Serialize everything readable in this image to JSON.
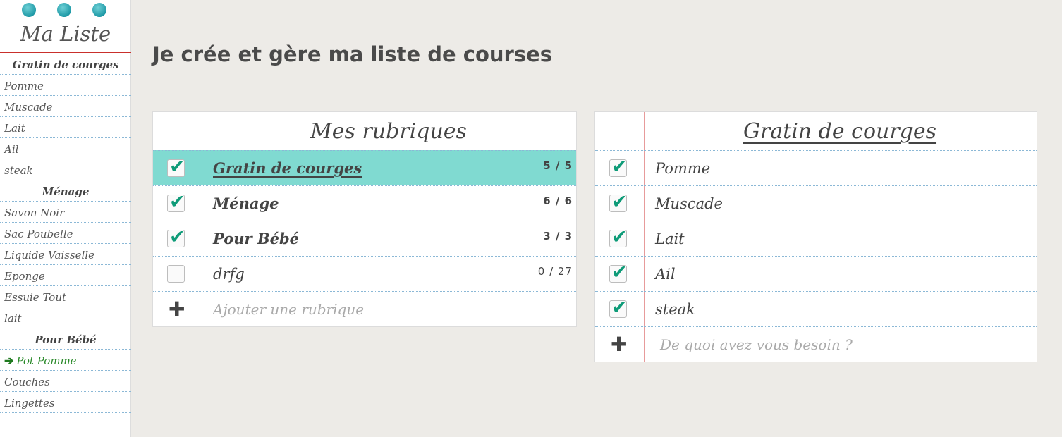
{
  "app": {
    "title": "Ma Liste"
  },
  "sidebar": {
    "rows": [
      {
        "label": "Gratin de courges",
        "type": "category"
      },
      {
        "label": "Pomme",
        "type": "item"
      },
      {
        "label": "Muscade",
        "type": "item"
      },
      {
        "label": "Lait",
        "type": "item"
      },
      {
        "label": "Ail",
        "type": "item"
      },
      {
        "label": "steak",
        "type": "item"
      },
      {
        "label": "Ménage",
        "type": "category"
      },
      {
        "label": "Savon Noir",
        "type": "item"
      },
      {
        "label": "Sac Poubelle",
        "type": "item"
      },
      {
        "label": "Liquide Vaisselle",
        "type": "item"
      },
      {
        "label": "Eponge",
        "type": "item"
      },
      {
        "label": "Essuie Tout",
        "type": "item"
      },
      {
        "label": "lait",
        "type": "item"
      },
      {
        "label": "Pour Bébé",
        "type": "category"
      },
      {
        "label": "Pot Pomme",
        "type": "item",
        "current": true
      },
      {
        "label": "Couches",
        "type": "item"
      },
      {
        "label": "Lingettes",
        "type": "item"
      }
    ],
    "current_icon": "arrow-right-icon"
  },
  "main": {
    "title": "Je crée et gère ma liste de courses"
  },
  "rubriques": {
    "title": "Mes rubriques",
    "rows": [
      {
        "label": "Gratin de courges",
        "count": "5 / 5",
        "checked": true,
        "selected": true
      },
      {
        "label": "Ménage",
        "count": "6 / 6",
        "checked": true,
        "selected": false
      },
      {
        "label": "Pour Bébé",
        "count": "3 / 3",
        "checked": true,
        "selected": false
      },
      {
        "label": "drfg",
        "count": "0 / 27",
        "checked": false,
        "selected": false
      }
    ],
    "add_placeholder": "Ajouter une rubrique"
  },
  "detail": {
    "title": "Gratin de courges",
    "items": [
      {
        "label": "Pomme",
        "checked": true
      },
      {
        "label": "Muscade",
        "checked": true
      },
      {
        "label": "Lait",
        "checked": true
      },
      {
        "label": "Ail",
        "checked": true
      },
      {
        "label": "steak",
        "checked": true
      }
    ],
    "add_placeholder": "De quoi avez vous besoin ?"
  },
  "colors": {
    "accent": "#80dad1",
    "check": "#0e9b78",
    "margin_red": "#e79b9b",
    "background": "#edebe7"
  }
}
